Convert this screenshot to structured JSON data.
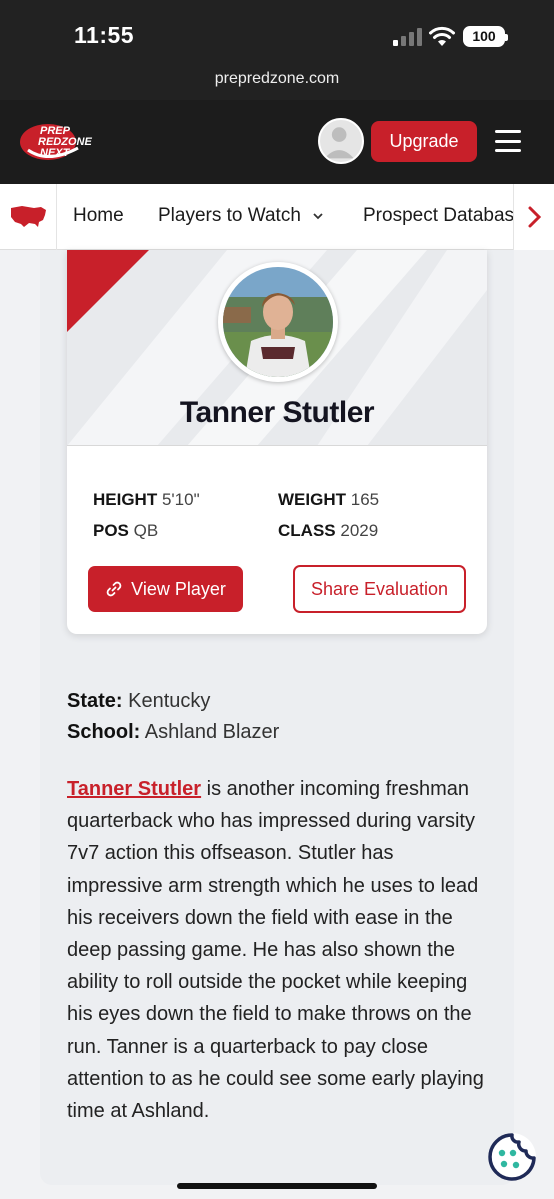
{
  "status_bar": {
    "time": "11:55",
    "battery": "100"
  },
  "browser": {
    "url": "prepredzone.com"
  },
  "header": {
    "logo_text": [
      "PREP",
      "REDZONE",
      "NEXT"
    ],
    "upgrade_label": "Upgrade"
  },
  "nav": {
    "items": [
      {
        "label": "Home"
      },
      {
        "label": "Players to Watch",
        "dropdown": true
      },
      {
        "label": "Prospect Database"
      }
    ]
  },
  "player": {
    "name": "Tanner Stutler",
    "stats": {
      "height_label": "HEIGHT",
      "height": "5'10\"",
      "weight_label": "WEIGHT",
      "weight": "165",
      "pos_label": "POS",
      "pos": "QB",
      "class_label": "CLASS",
      "class": "2029"
    },
    "view_button": "View Player",
    "share_button": "Share Evaluation"
  },
  "info": {
    "state_label": "State:",
    "state": "Kentucky",
    "school_label": "School:",
    "school": "Ashland Blazer"
  },
  "bio": {
    "link_text": "Tanner Stutler",
    "text": " is another incoming freshman quarterback who has impressed during varsity 7v7 action this offseason. Stutler has impressive arm strength which he uses to lead his receivers down the field with ease in the deep passing game. He has also shown the ability to roll outside the pocket while keeping his eyes down the field to make throws on the run. Tanner is a quarterback to pay close attention to as he could see some early playing time at Ashland."
  },
  "colors": {
    "brand_red": "#c8202a",
    "header_dark": "#1c1c1c"
  }
}
